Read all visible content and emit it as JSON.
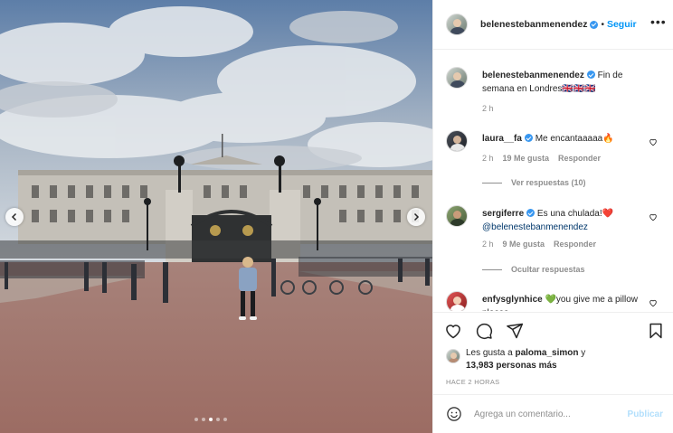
{
  "colors": {
    "accent": "#0095f6",
    "verified": "#3897f0",
    "muted": "#8e8e8e",
    "publish_disabled": "#b2dffc"
  },
  "carousel": {
    "slide_count": 5,
    "active_index": 2
  },
  "header": {
    "username": "belenestebanmenendez",
    "separator": "•",
    "follow_label": "Seguir",
    "more_icon": "more-horizontal-icon"
  },
  "caption": {
    "username": "belenestebanmenendez",
    "text": "Fin de semana en Londres🇬🇧🇬🇧🇬🇧",
    "time": "2 h"
  },
  "comments": [
    {
      "username": "laura__fa",
      "text": "Me encantaaaaa🔥",
      "time": "2 h",
      "likes": "19 Me gusta",
      "reply": "Responder",
      "replies_label": "Ver respuestas (10)"
    },
    {
      "username": "sergiferre",
      "text": "Es una chulada!❤️",
      "mention": "@belenestebanmenendez",
      "time": "2 h",
      "likes": "9 Me gusta",
      "reply": "Responder",
      "replies_label": "Ocultar respuestas"
    },
    {
      "username": "enfysglynhice",
      "text": "💚you give me a pillow please"
    }
  ],
  "actions": {
    "like_icon": "heart-icon",
    "comment_icon": "comment-icon",
    "share_icon": "share-icon",
    "save_icon": "bookmark-icon"
  },
  "likes": {
    "prefix": "Les gusta a ",
    "user": "paloma_simon",
    "suffix": " y",
    "count_line": "13,983 personas más"
  },
  "posted": "HACE 2 HORAS",
  "add_comment": {
    "placeholder": "Agrega un comentario...",
    "publish_label": "Publicar"
  }
}
